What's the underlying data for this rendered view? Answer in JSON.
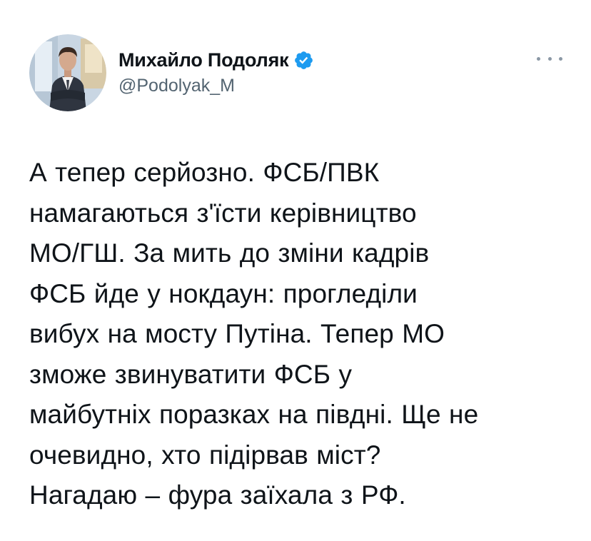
{
  "author": {
    "display_name": "Михайло Подоляк",
    "handle": "@Podolyak_M",
    "avatar_icon": "profile-photo",
    "verified_icon": "verified-badge-icon",
    "verified_color": "#1d9bf0"
  },
  "more_icon": "more-options-icon",
  "tweet": {
    "text": "А тепер серйозно. ФСБ/ПВК\nнамагаються з'їсти керівництво\nМО/ГШ. За мить до зміни кадрів\nФСБ йде у нокдаун: прогледіли\nвибух на мосту Путіна. Тепер МО\nзможе звинуватити ФСБ у\nмайбутніх поразках на півдні. Ще не\nочевидно, хто підірвав міст?\nНагадаю – фура заїхала з РФ."
  },
  "colors": {
    "text_primary": "#0f1419",
    "text_secondary": "#536471",
    "background": "#ffffff"
  }
}
